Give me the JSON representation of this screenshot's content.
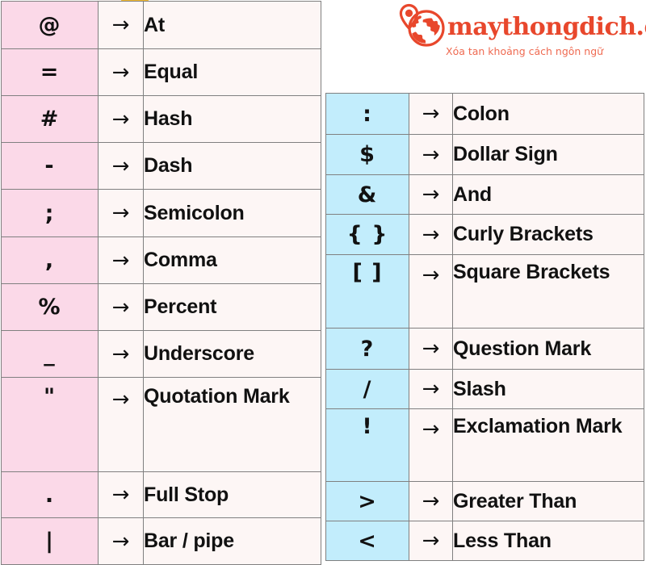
{
  "logo": {
    "name": "maythongdich.com",
    "tagline": "Xóa tan khoảng cách ngôn ngữ",
    "mark": "map-pin-globe-icon",
    "color": "#e8472c",
    "tagline_color": "#ef6a51"
  },
  "arrow_glyph": "→",
  "left_table": {
    "accent_color": "#fbd9e8",
    "cell_color": "#fdf6f5",
    "border_color": "#808080",
    "rows": [
      {
        "symbol": "@",
        "name": "At"
      },
      {
        "symbol": "=",
        "name": "Equal"
      },
      {
        "symbol": "#",
        "name": "Hash"
      },
      {
        "symbol": "-",
        "name": "Dash"
      },
      {
        "symbol": ";",
        "name": "Semicolon"
      },
      {
        "symbol": ",",
        "name": "Comma"
      },
      {
        "symbol": "%",
        "name": "Percent"
      },
      {
        "symbol": "_",
        "name": "Underscore"
      },
      {
        "symbol": "\"",
        "name": "Quotation Mark"
      },
      {
        "symbol": ".",
        "name": "Full Stop"
      },
      {
        "symbol": "|",
        "name": "Bar / pipe"
      }
    ]
  },
  "right_table": {
    "accent_color": "#c2edfc",
    "cell_color": "#fdf6f5",
    "border_color": "#808080",
    "rows": [
      {
        "symbol": ":",
        "name": "Colon"
      },
      {
        "symbol": "$",
        "name": "Dollar Sign"
      },
      {
        "symbol": "&",
        "name": "And"
      },
      {
        "symbol": "{ }",
        "name": "Curly Brackets"
      },
      {
        "symbol": "[ ]",
        "name": "Square Brackets"
      },
      {
        "symbol": "?",
        "name": "Question Mark"
      },
      {
        "symbol": "/",
        "name": "Slash"
      },
      {
        "symbol": "!",
        "name": "Exclamation Mark"
      },
      {
        "symbol": ">",
        "name": "Greater Than"
      },
      {
        "symbol": "<",
        "name": "Less Than"
      }
    ]
  }
}
